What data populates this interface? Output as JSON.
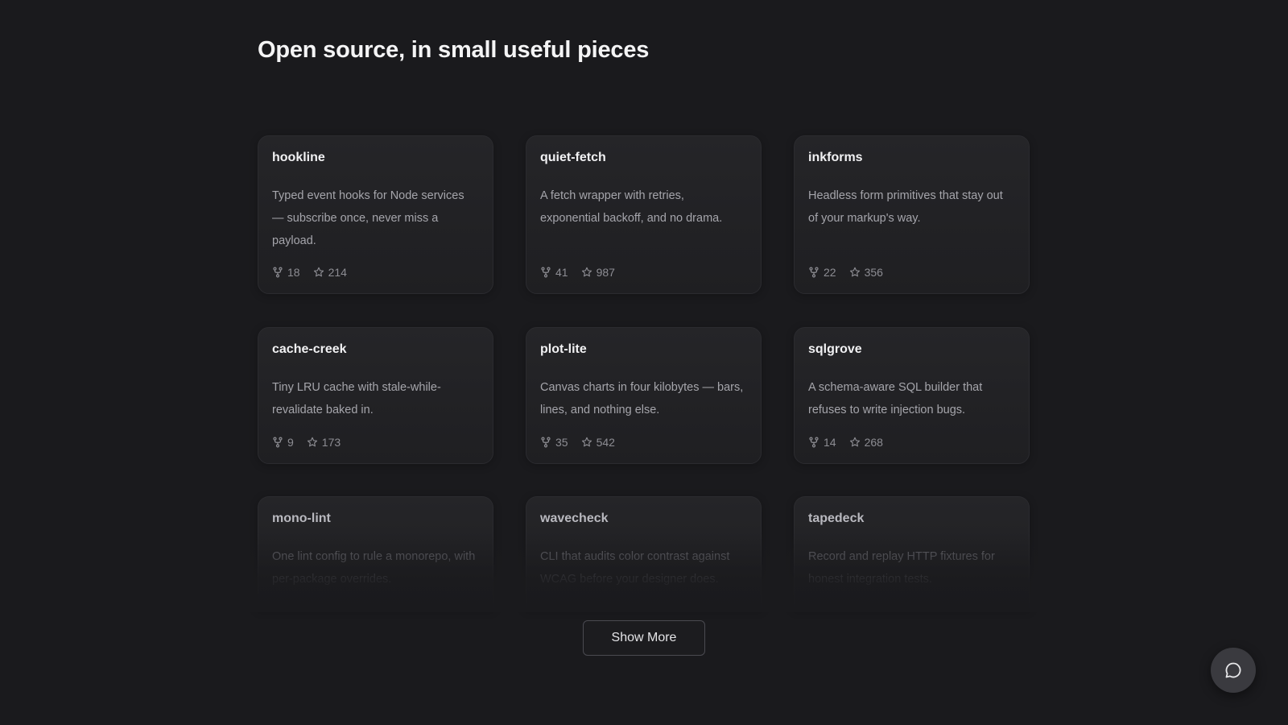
{
  "heading": "Open source, in small useful pieces",
  "projects": [
    {
      "name": "hookline",
      "description": "Typed event hooks for Node services — subscribe once, never miss a payload.",
      "forks": "18",
      "stars": "214"
    },
    {
      "name": "quiet-fetch",
      "description": "A fetch wrapper with retries, exponential backoff, and no drama.",
      "forks": "41",
      "stars": "987"
    },
    {
      "name": "inkforms",
      "description": "Headless form primitives that stay out of your markup's way.",
      "forks": "22",
      "stars": "356"
    },
    {
      "name": "cache-creek",
      "description": "Tiny LRU cache with stale-while-revalidate baked in.",
      "forks": "9",
      "stars": "173"
    },
    {
      "name": "plot-lite",
      "description": "Canvas charts in four kilobytes — bars, lines, and nothing else.",
      "forks": "35",
      "stars": "542"
    },
    {
      "name": "sqlgrove",
      "description": "A schema-aware SQL builder that refuses to write injection bugs.",
      "forks": "14",
      "stars": "268"
    },
    {
      "name": "mono-lint",
      "description": "One lint config to rule a monorepo, with per-package overrides."
    },
    {
      "name": "wavecheck",
      "description": "CLI that audits color contrast against WCAG before your designer does."
    },
    {
      "name": "tapedeck",
      "description": "Record and replay HTTP fixtures for honest integration tests."
    }
  ],
  "show_more_label": "Show More",
  "icons": {
    "fork": "fork-icon",
    "star": "star-icon",
    "chat": "chat-bubble-icon"
  },
  "colors": {
    "background": "#1a1a1d",
    "card": "#232326",
    "accent_text": "#f1f1f3"
  }
}
